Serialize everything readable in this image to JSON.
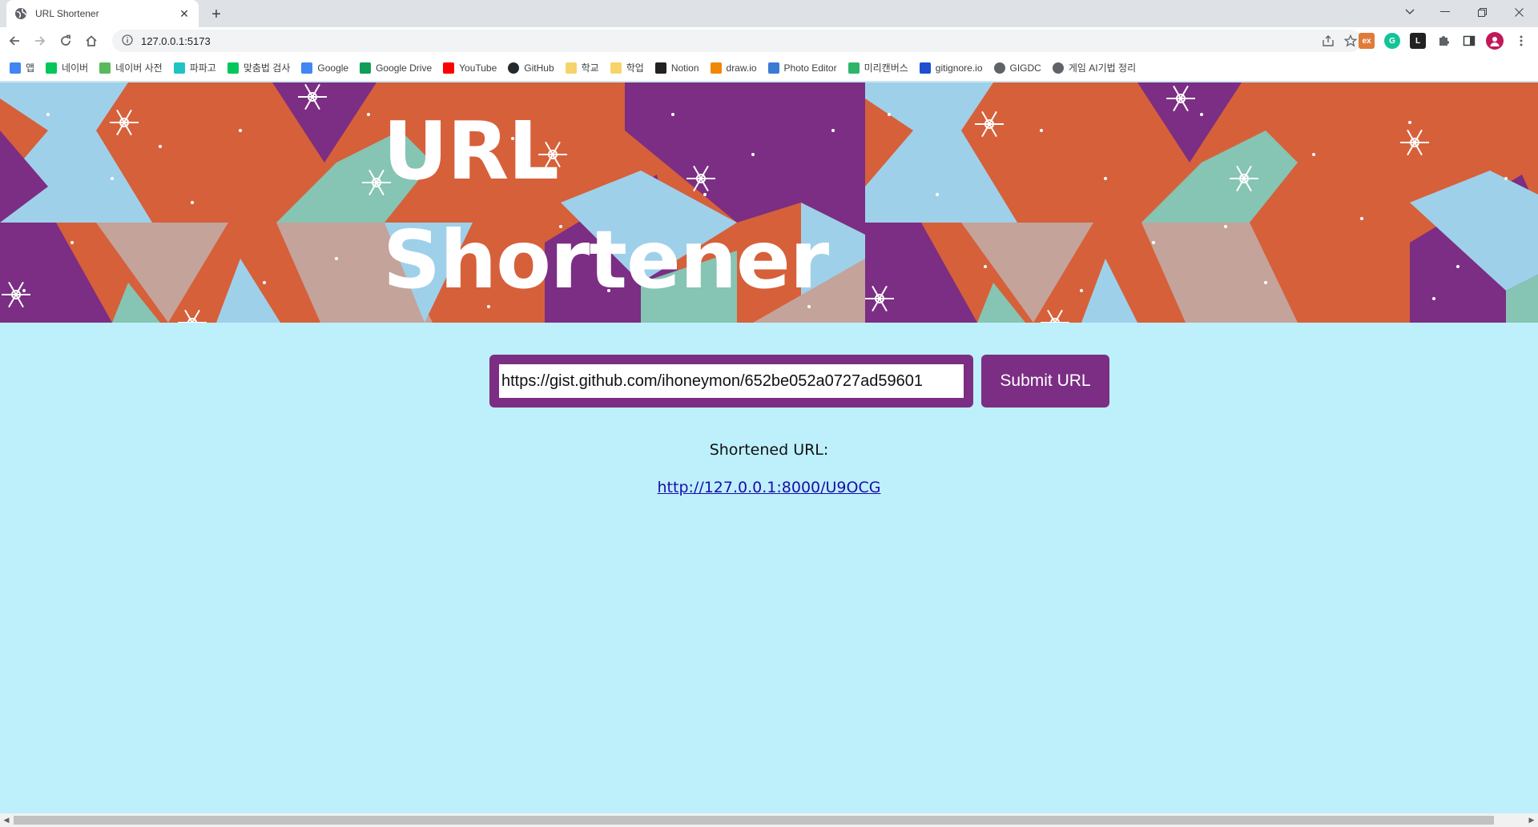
{
  "browser": {
    "tab_title": "URL Shortener",
    "new_tab": "+",
    "address": "127.0.0.1:5173",
    "bookmarks": [
      {
        "label": "앱",
        "icon": "apps-icon",
        "color": "#4285f4"
      },
      {
        "label": "네이버",
        "icon": "naver-icon",
        "color": "#03c75a"
      },
      {
        "label": "네이버 사전",
        "icon": "naver-dict-icon",
        "color": "#5cb85c"
      },
      {
        "label": "파파고",
        "icon": "papago-icon",
        "color": "#1ec4c4"
      },
      {
        "label": "맞춤법 검사",
        "icon": "naver-icon",
        "color": "#03c75a"
      },
      {
        "label": "Google",
        "icon": "google-icon",
        "color": "#4285f4"
      },
      {
        "label": "Google Drive",
        "icon": "google-drive-icon",
        "color": "#0f9d58"
      },
      {
        "label": "YouTube",
        "icon": "youtube-icon",
        "color": "#ff0000"
      },
      {
        "label": "GitHub",
        "icon": "github-icon",
        "color": "#24292e"
      },
      {
        "label": "학교",
        "icon": "folder-icon",
        "color": "#f6d36b"
      },
      {
        "label": "학업",
        "icon": "folder-icon",
        "color": "#f6d36b"
      },
      {
        "label": "Notion",
        "icon": "notion-icon",
        "color": "#222222"
      },
      {
        "label": "draw.io",
        "icon": "drawio-icon",
        "color": "#f08705"
      },
      {
        "label": "Photo Editor",
        "icon": "photo-editor-icon",
        "color": "#3b7bd4"
      },
      {
        "label": "미리캔버스",
        "icon": "miricanvas-icon",
        "color": "#2fb56a"
      },
      {
        "label": "gitignore.io",
        "icon": "gitignore-icon",
        "color": "#204ecf"
      },
      {
        "label": "GIGDC",
        "icon": "globe-icon",
        "color": "#5f6368"
      },
      {
        "label": "게임 AI기법 정리",
        "icon": "globe-icon",
        "color": "#5f6368"
      }
    ]
  },
  "page": {
    "title_line1": "URL",
    "title_line2": "Shortener",
    "url_input_value": "https://gist.github.com/ihoneymon/652be052a0727ad59601",
    "submit_label": "Submit URL",
    "result_label": "Shortened URL:",
    "result_link": "http://127.0.0.1:8000/U9OCG"
  },
  "colors": {
    "page_background": "#bdf0fb",
    "accent_purple": "#7b2e83",
    "banner_orange": "#d6603a",
    "banner_light_blue": "#9fd0ea",
    "banner_teal": "#86c4b3",
    "banner_rose": "#c4a39b"
  }
}
